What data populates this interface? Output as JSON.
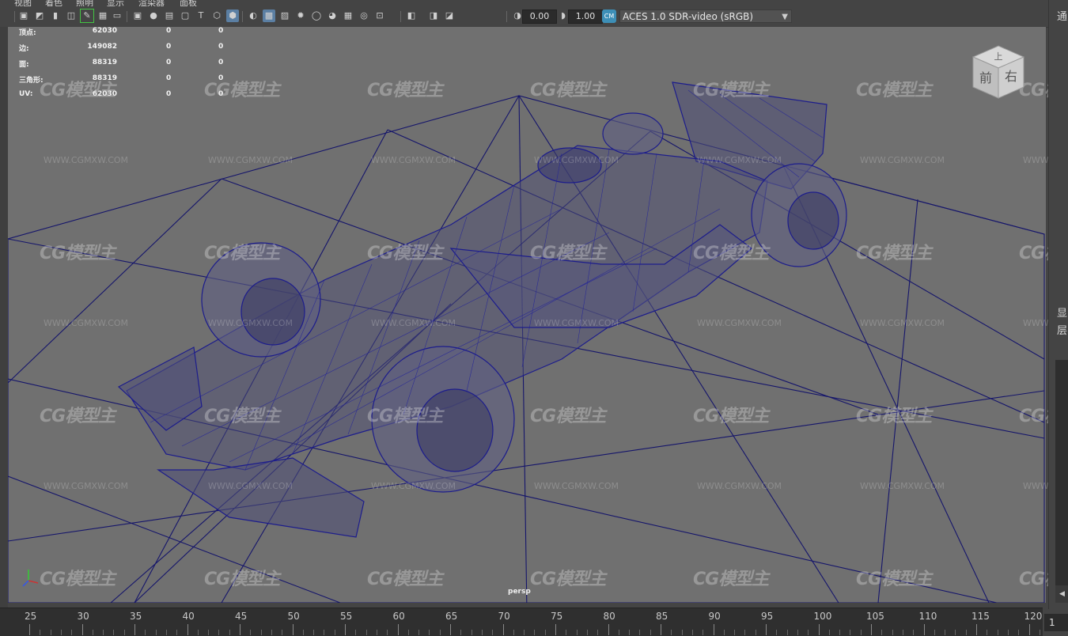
{
  "menu": {
    "items": [
      "视图",
      "着色",
      "照明",
      "显示",
      "渲染器",
      "面板"
    ]
  },
  "toolbar": {
    "exposure_value": "0.00",
    "gamma_value": "1.00",
    "colorspace_label": "ACES 1.0 SDR-video (sRGB)",
    "icons": [
      "camera-select-icon",
      "camera-attributes-icon",
      "bookmark-icon",
      "image-plane-icon",
      "grease-pencil-icon",
      "grid-icon",
      "film-gate-icon",
      "resolution-gate-icon",
      "gate-mask-icon",
      "field-chart-icon",
      "safe-action-icon",
      "safe-title-icon",
      "wireframe-icon",
      "smooth-shade-icon",
      "default-material-icon",
      "textured-icon",
      "shadows-icon",
      "lights-icon",
      "ambient-occlusion-icon",
      "motion-blur-icon",
      "antialias-icon",
      "depth-of-field-icon",
      "isolate-select-icon",
      "xray-icon",
      "xray-joints-icon",
      "xray-active-icon",
      "exposure-icon",
      "gamma-icon",
      "color-management-icon"
    ]
  },
  "hud": {
    "rows": [
      {
        "label": "顶点:",
        "v1": "62030",
        "v2": "0",
        "v3": "0"
      },
      {
        "label": "边:",
        "v1": "149082",
        "v2": "0",
        "v3": "0"
      },
      {
        "label": "面:",
        "v1": "88319",
        "v2": "0",
        "v3": "0"
      },
      {
        "label": "三角形:",
        "v1": "88319",
        "v2": "0",
        "v3": "0"
      },
      {
        "label": "UV:",
        "v1": "62030",
        "v2": "0",
        "v3": "0"
      }
    ]
  },
  "viewport": {
    "camera_label": "persp",
    "viewcube_top": "上",
    "viewcube_front": "前",
    "viewcube_right": "右",
    "watermark_logo": "CG模型主",
    "watermark_url": "WWW.CGMXW.COM",
    "axis_labels": {
      "x": "x",
      "y": "y",
      "z": "z"
    }
  },
  "right_panel": {
    "top_text": "通",
    "mid_text_1": "显",
    "mid_text_2": "层"
  },
  "timeline": {
    "ticks": [
      "25",
      "30",
      "35",
      "40",
      "45",
      "50",
      "55",
      "60",
      "65",
      "70",
      "75",
      "80",
      "85",
      "90",
      "95",
      "100",
      "105",
      "110",
      "115",
      "120"
    ],
    "current_frame": "1"
  },
  "colors": {
    "viewport_bg": "#707070",
    "wire": "#1a1a8a",
    "grid": "#17176a",
    "ui_bg": "#444444"
  }
}
